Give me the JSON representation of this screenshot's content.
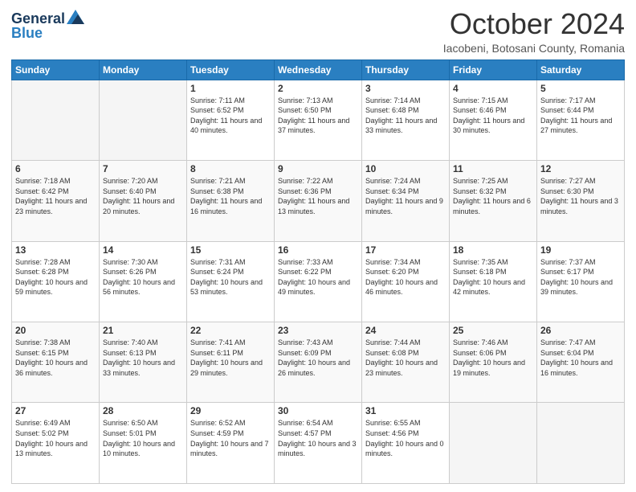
{
  "header": {
    "logo_line1": "General",
    "logo_line2": "Blue",
    "month": "October 2024",
    "location": "Iacobeni, Botosani County, Romania"
  },
  "weekdays": [
    "Sunday",
    "Monday",
    "Tuesday",
    "Wednesday",
    "Thursday",
    "Friday",
    "Saturday"
  ],
  "weeks": [
    [
      {
        "day": "",
        "info": ""
      },
      {
        "day": "",
        "info": ""
      },
      {
        "day": "1",
        "info": "Sunrise: 7:11 AM\nSunset: 6:52 PM\nDaylight: 11 hours and 40 minutes."
      },
      {
        "day": "2",
        "info": "Sunrise: 7:13 AM\nSunset: 6:50 PM\nDaylight: 11 hours and 37 minutes."
      },
      {
        "day": "3",
        "info": "Sunrise: 7:14 AM\nSunset: 6:48 PM\nDaylight: 11 hours and 33 minutes."
      },
      {
        "day": "4",
        "info": "Sunrise: 7:15 AM\nSunset: 6:46 PM\nDaylight: 11 hours and 30 minutes."
      },
      {
        "day": "5",
        "info": "Sunrise: 7:17 AM\nSunset: 6:44 PM\nDaylight: 11 hours and 27 minutes."
      }
    ],
    [
      {
        "day": "6",
        "info": "Sunrise: 7:18 AM\nSunset: 6:42 PM\nDaylight: 11 hours and 23 minutes."
      },
      {
        "day": "7",
        "info": "Sunrise: 7:20 AM\nSunset: 6:40 PM\nDaylight: 11 hours and 20 minutes."
      },
      {
        "day": "8",
        "info": "Sunrise: 7:21 AM\nSunset: 6:38 PM\nDaylight: 11 hours and 16 minutes."
      },
      {
        "day": "9",
        "info": "Sunrise: 7:22 AM\nSunset: 6:36 PM\nDaylight: 11 hours and 13 minutes."
      },
      {
        "day": "10",
        "info": "Sunrise: 7:24 AM\nSunset: 6:34 PM\nDaylight: 11 hours and 9 minutes."
      },
      {
        "day": "11",
        "info": "Sunrise: 7:25 AM\nSunset: 6:32 PM\nDaylight: 11 hours and 6 minutes."
      },
      {
        "day": "12",
        "info": "Sunrise: 7:27 AM\nSunset: 6:30 PM\nDaylight: 11 hours and 3 minutes."
      }
    ],
    [
      {
        "day": "13",
        "info": "Sunrise: 7:28 AM\nSunset: 6:28 PM\nDaylight: 10 hours and 59 minutes."
      },
      {
        "day": "14",
        "info": "Sunrise: 7:30 AM\nSunset: 6:26 PM\nDaylight: 10 hours and 56 minutes."
      },
      {
        "day": "15",
        "info": "Sunrise: 7:31 AM\nSunset: 6:24 PM\nDaylight: 10 hours and 53 minutes."
      },
      {
        "day": "16",
        "info": "Sunrise: 7:33 AM\nSunset: 6:22 PM\nDaylight: 10 hours and 49 minutes."
      },
      {
        "day": "17",
        "info": "Sunrise: 7:34 AM\nSunset: 6:20 PM\nDaylight: 10 hours and 46 minutes."
      },
      {
        "day": "18",
        "info": "Sunrise: 7:35 AM\nSunset: 6:18 PM\nDaylight: 10 hours and 42 minutes."
      },
      {
        "day": "19",
        "info": "Sunrise: 7:37 AM\nSunset: 6:17 PM\nDaylight: 10 hours and 39 minutes."
      }
    ],
    [
      {
        "day": "20",
        "info": "Sunrise: 7:38 AM\nSunset: 6:15 PM\nDaylight: 10 hours and 36 minutes."
      },
      {
        "day": "21",
        "info": "Sunrise: 7:40 AM\nSunset: 6:13 PM\nDaylight: 10 hours and 33 minutes."
      },
      {
        "day": "22",
        "info": "Sunrise: 7:41 AM\nSunset: 6:11 PM\nDaylight: 10 hours and 29 minutes."
      },
      {
        "day": "23",
        "info": "Sunrise: 7:43 AM\nSunset: 6:09 PM\nDaylight: 10 hours and 26 minutes."
      },
      {
        "day": "24",
        "info": "Sunrise: 7:44 AM\nSunset: 6:08 PM\nDaylight: 10 hours and 23 minutes."
      },
      {
        "day": "25",
        "info": "Sunrise: 7:46 AM\nSunset: 6:06 PM\nDaylight: 10 hours and 19 minutes."
      },
      {
        "day": "26",
        "info": "Sunrise: 7:47 AM\nSunset: 6:04 PM\nDaylight: 10 hours and 16 minutes."
      }
    ],
    [
      {
        "day": "27",
        "info": "Sunrise: 6:49 AM\nSunset: 5:02 PM\nDaylight: 10 hours and 13 minutes."
      },
      {
        "day": "28",
        "info": "Sunrise: 6:50 AM\nSunset: 5:01 PM\nDaylight: 10 hours and 10 minutes."
      },
      {
        "day": "29",
        "info": "Sunrise: 6:52 AM\nSunset: 4:59 PM\nDaylight: 10 hours and 7 minutes."
      },
      {
        "day": "30",
        "info": "Sunrise: 6:54 AM\nSunset: 4:57 PM\nDaylight: 10 hours and 3 minutes."
      },
      {
        "day": "31",
        "info": "Sunrise: 6:55 AM\nSunset: 4:56 PM\nDaylight: 10 hours and 0 minutes."
      },
      {
        "day": "",
        "info": ""
      },
      {
        "day": "",
        "info": ""
      }
    ]
  ]
}
